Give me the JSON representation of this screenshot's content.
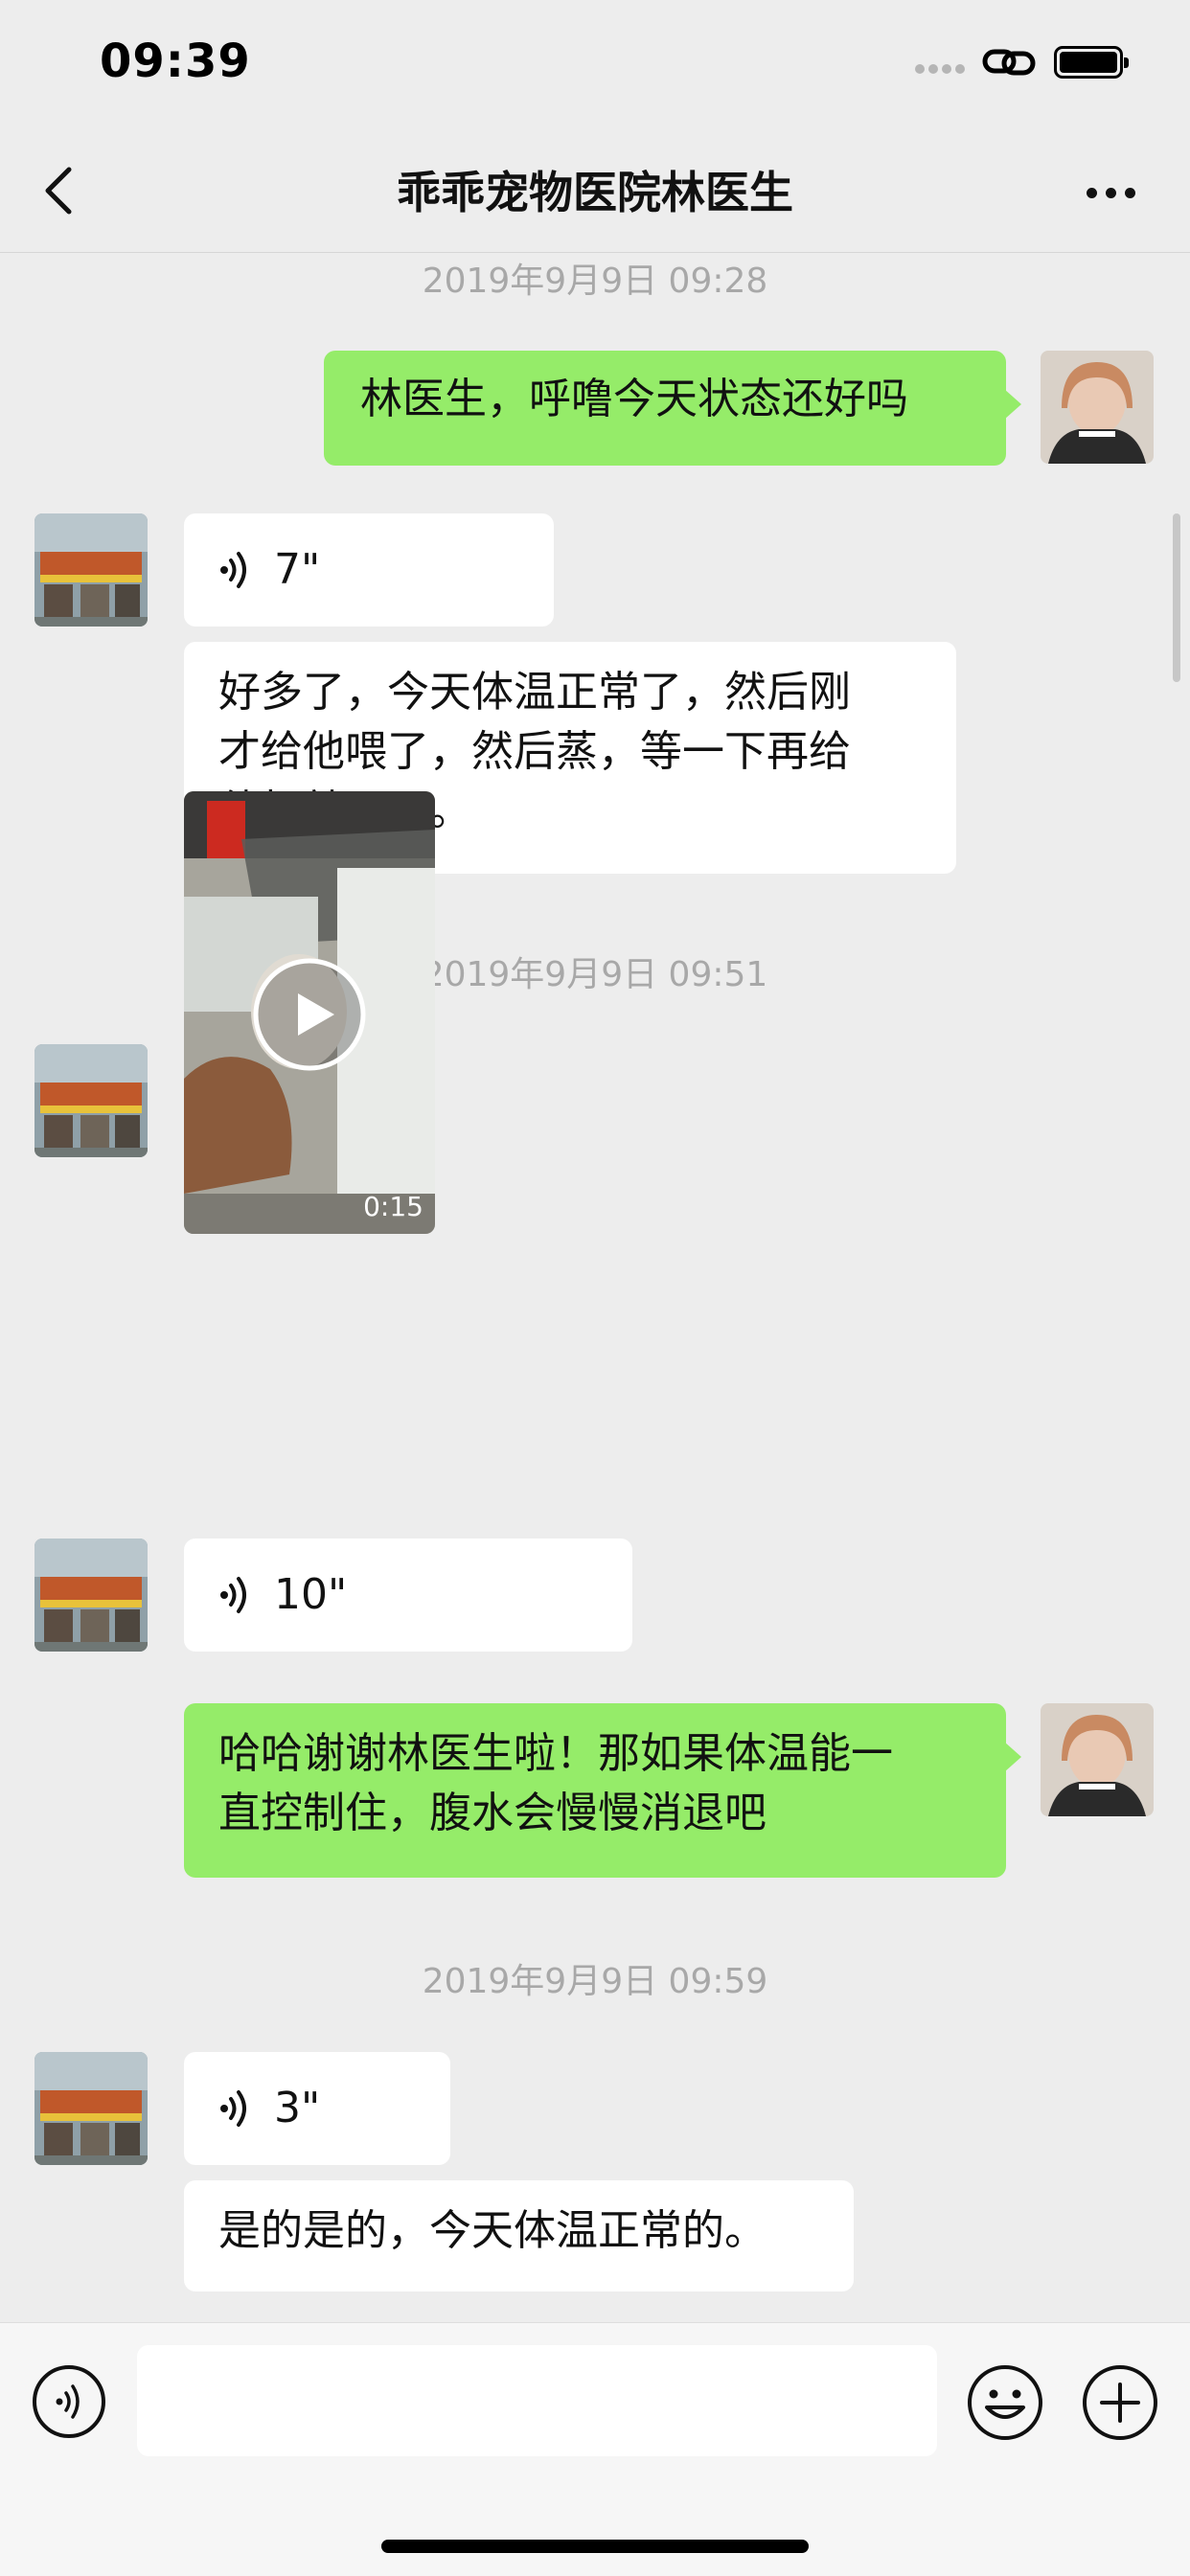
{
  "status_bar": {
    "time": "09:39"
  },
  "nav": {
    "title": "乖乖宠物医院林医生"
  },
  "messages": {
    "ts1": "2019年9月9日 09:28",
    "m1": "林医生，呼噜今天状态还好吗",
    "v1": "7\"",
    "m2_line1": "好多了，今天体温正常了，然后刚",
    "m2_line2": "才给他喂了，然后蒸，等一下再给",
    "m2_line3": "他打就可以。",
    "ts2": "2019年9月9日 09:51",
    "video_duration": "0:15",
    "v2": "10\"",
    "m3_line1": "哈哈谢谢林医生啦！那如果体温能一",
    "m3_line2": "直控制住，腹水会慢慢消退吧",
    "ts3": "2019年9月9日 09:59",
    "v3": "3\"",
    "m4": "是的是的，今天体温正常的。"
  },
  "input": {
    "value": "",
    "placeholder": ""
  },
  "colors": {
    "background": "#ededed",
    "sent_bubble": "#95ec69",
    "received_bubble": "#ffffff",
    "timestamp": "#a8a8a8"
  },
  "icons": [
    "back-icon",
    "more-icon",
    "voice-wave-icon",
    "play-icon",
    "voice-toggle-icon",
    "emoji-icon",
    "plus-icon",
    "link-icon",
    "battery-icon"
  ]
}
